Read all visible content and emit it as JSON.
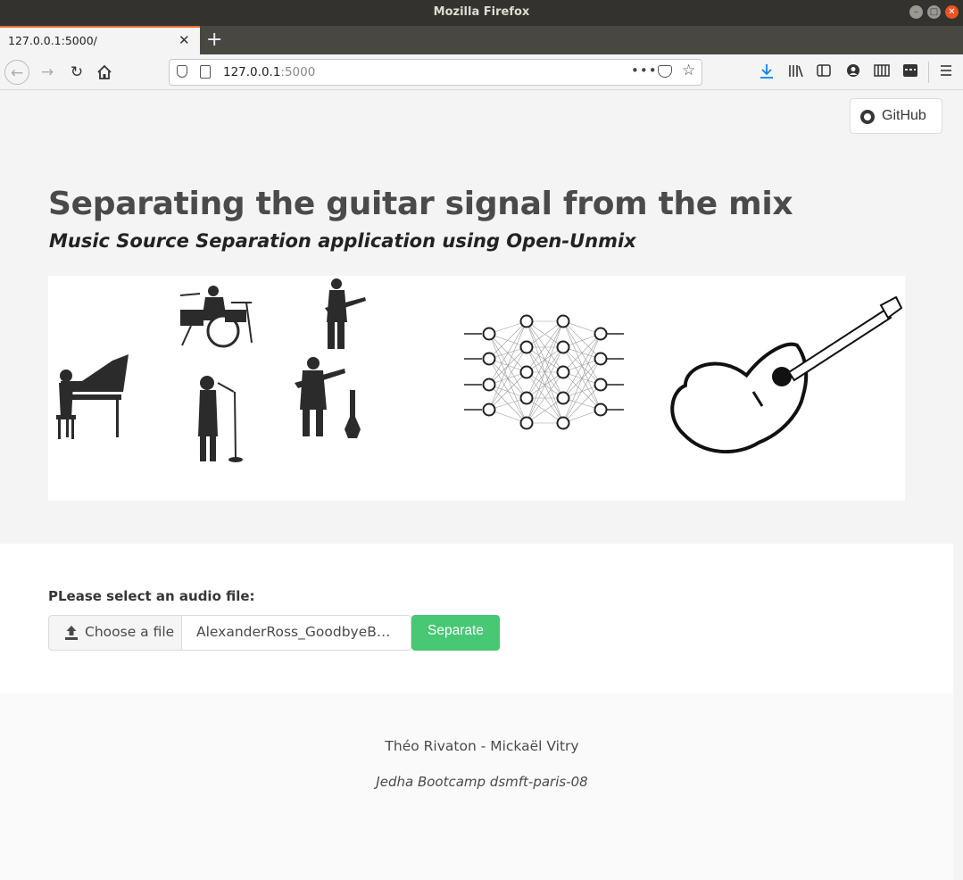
{
  "window": {
    "title": "Mozilla Firefox"
  },
  "tabs": [
    {
      "title": "127.0.0.1:5000/"
    }
  ],
  "address_bar": {
    "host": "127.0.0.1",
    "port": ":5000"
  },
  "header": {
    "github_label": "GitHub"
  },
  "hero": {
    "title": "Separating the guitar signal from the mix",
    "subtitle": "Music Source Separation application using Open-Unmix"
  },
  "upload": {
    "label": "PLease select an audio file:",
    "choose_label": "Choose a file",
    "file_name": "AlexanderRoss_GoodbyeBolero_MIX.wav",
    "separate_label": "Separate",
    "accent_color": "#48c774"
  },
  "footer": {
    "authors": "Théo Rivaton - Mickaël Vitry",
    "bootcamp": "Jedha Bootcamp dsmft-paris-08"
  }
}
